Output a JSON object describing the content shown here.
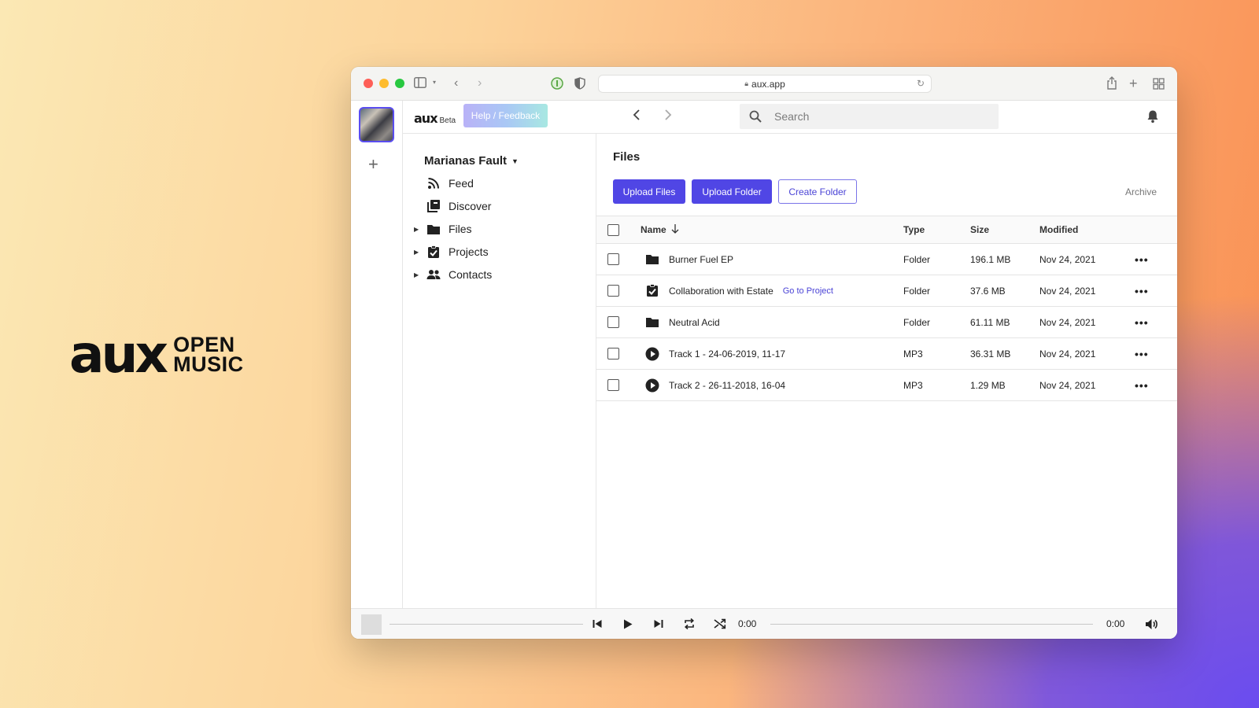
{
  "brand": {
    "mark": "aux",
    "line1": "OPEN",
    "line2": "MUSIC"
  },
  "browser": {
    "url": "aux.app"
  },
  "topbar": {
    "logo": "aux",
    "logo_badge": "Beta",
    "help_label": "Help / Feedback",
    "search_placeholder": "Search"
  },
  "sidebar": {
    "workspace": "Marianas Fault",
    "items": [
      {
        "label": "Feed",
        "icon": "rss-icon",
        "expandable": false
      },
      {
        "label": "Discover",
        "icon": "library-icon",
        "expandable": false
      },
      {
        "label": "Files",
        "icon": "folder-icon",
        "expandable": true
      },
      {
        "label": "Projects",
        "icon": "checkbox-icon",
        "expandable": true
      },
      {
        "label": "Contacts",
        "icon": "people-icon",
        "expandable": true
      }
    ]
  },
  "main": {
    "title": "Files",
    "buttons": {
      "upload_files": "Upload Files",
      "upload_folder": "Upload Folder",
      "create_folder": "Create Folder"
    },
    "archive_label": "Archive",
    "columns": {
      "name": "Name",
      "type": "Type",
      "size": "Size",
      "modified": "Modified"
    },
    "rows": [
      {
        "name": "Burner Fuel EP",
        "icon": "folder-icon",
        "type": "Folder",
        "size": "196.1 MB",
        "modified": "Nov 24, 2021",
        "link": ""
      },
      {
        "name": "Collaboration with Estate",
        "icon": "project-icon",
        "type": "Folder",
        "size": "37.6 MB",
        "modified": "Nov 24, 2021",
        "link": "Go to Project"
      },
      {
        "name": "Neutral Acid",
        "icon": "folder-icon",
        "type": "Folder",
        "size": "61.11 MB",
        "modified": "Nov 24, 2021",
        "link": ""
      },
      {
        "name": "Track 1 - 24-06-2019, 11-17",
        "icon": "play-circle-icon",
        "type": "MP3",
        "size": "36.31 MB",
        "modified": "Nov 24, 2021",
        "link": ""
      },
      {
        "name": "Track 2 - 26-11-2018, 16-04",
        "icon": "play-circle-icon",
        "type": "MP3",
        "size": "1.29 MB",
        "modified": "Nov 24, 2021",
        "link": ""
      }
    ]
  },
  "player": {
    "elapsed": "0:00",
    "duration": "0:00"
  }
}
